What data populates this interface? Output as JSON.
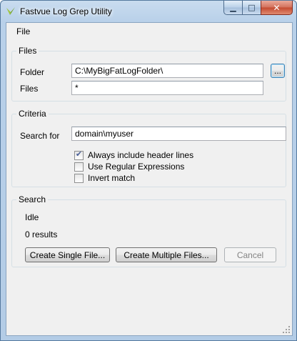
{
  "window": {
    "title": "Fastvue Log Grep Utility",
    "buttons": {
      "minimize": "▁",
      "maximize": "□",
      "close": "✕"
    }
  },
  "menu": {
    "file": "File"
  },
  "files_group": {
    "title": "Files",
    "folder_label": "Folder",
    "folder_value": "C:\\MyBigFatLogFolder\\",
    "browse_label": "...",
    "files_label": "Files",
    "files_value": "*"
  },
  "criteria_group": {
    "title": "Criteria",
    "search_label": "Search for",
    "search_value": "domain\\myuser",
    "options": [
      {
        "label": "Always include header lines",
        "checked": true
      },
      {
        "label": "Use Regular Expressions",
        "checked": false
      },
      {
        "label": "Invert match",
        "checked": false
      }
    ]
  },
  "search_group": {
    "title": "Search",
    "status": "Idle",
    "results": "0 results",
    "create_single_label": "Create Single File...",
    "create_multiple_label": "Create Multiple Files...",
    "cancel_label": "Cancel"
  },
  "colors": {
    "accent": "#3c7fb1",
    "check": "#4a5f97"
  }
}
